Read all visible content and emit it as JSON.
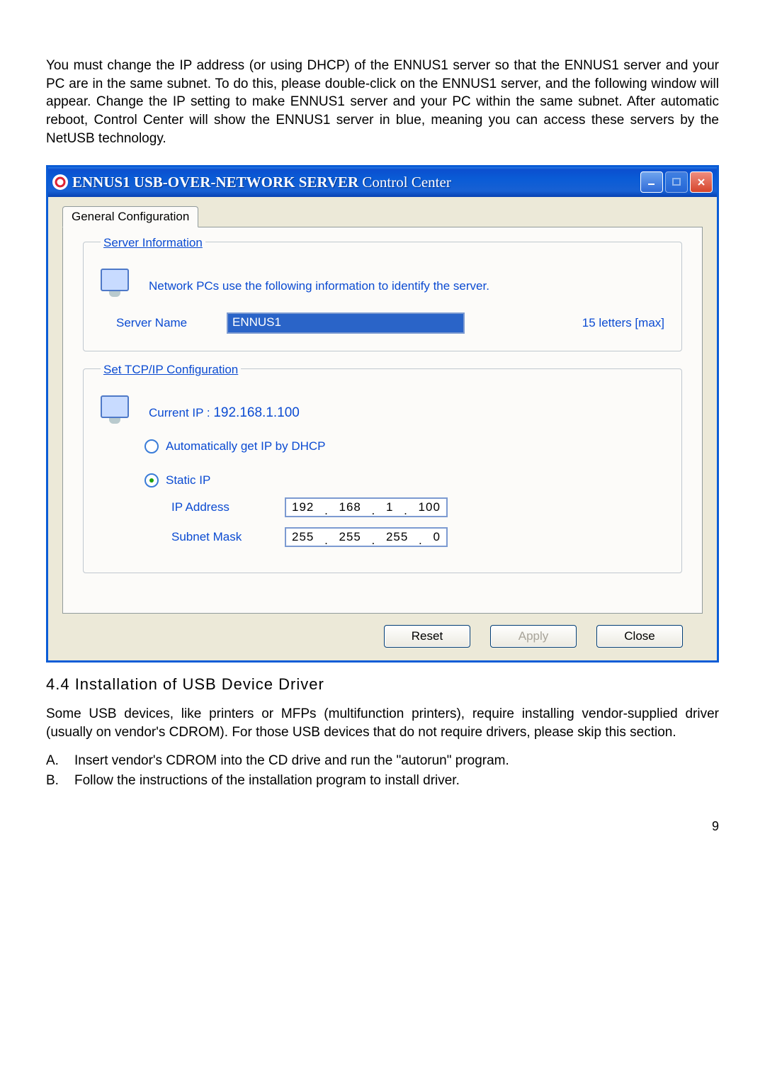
{
  "doc": {
    "para1": "You must change the IP address (or using DHCP) of the ENNUS1 server so that the ENNUS1 server and your PC are in the same subnet. To do this, please double-click on the ENNUS1 server, and the following window will appear. Change the IP setting to make ENNUS1 server and your PC within the same subnet. After automatic reboot, Control Center will show the ENNUS1 server in blue, meaning you can access these servers by the NetUSB technology.",
    "heading": "4.4    Installation of USB Device Driver",
    "para2": "Some USB devices, like printers or MFPs (multifunction printers), require installing vendor-supplied driver (usually on vendor's CDROM). For those USB devices that do not require drivers, please skip this section.",
    "listA": "Insert vendor's CDROM into the CD drive and run the \"autorun\" program.",
    "listB": "Follow the instructions of the installation program to install driver.",
    "page_number": "9"
  },
  "window": {
    "title_bold1": "ENNUS1 USB-OVER-NETWORK  SERVER",
    "title_light": " Control Center",
    "tab": "General Configuration",
    "server_info": {
      "legend": "Server Information",
      "desc": "Network PCs use the following information to identify the server.",
      "name_label": "Server Name",
      "name_value": "ENNUS1",
      "hint": "15 letters [max]"
    },
    "tcpip": {
      "legend": "Set TCP/IP Configuration",
      "current_label": "Current IP :",
      "current_value": "192.168.1.100",
      "radio_dhcp": "Automatically get IP by DHCP",
      "radio_static": "Static IP",
      "ip_label": "IP Address",
      "ip_value": {
        "a": "192",
        "b": "168",
        "c": "1",
        "d": "100"
      },
      "mask_label": "Subnet Mask",
      "mask_value": {
        "a": "255",
        "b": "255",
        "c": "255",
        "d": "0"
      }
    },
    "buttons": {
      "reset": "Reset",
      "apply": "Apply",
      "close": "Close"
    }
  }
}
